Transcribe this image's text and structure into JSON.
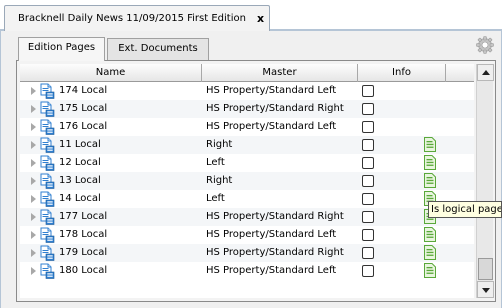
{
  "document_tab": {
    "title": "Bracknell Daily News 11/09/2015 First Edition",
    "close_label": "x"
  },
  "tabs": {
    "edition_pages": "Edition Pages",
    "ext_documents": "Ext. Documents"
  },
  "columns": {
    "name": "Name",
    "master": "Master",
    "info": "Info"
  },
  "rows": [
    {
      "name": "174 Local",
      "master": "HS Property/Standard Left",
      "logical": false
    },
    {
      "name": "175 Local",
      "master": "HS Property/Standard Right",
      "logical": false
    },
    {
      "name": "176 Local",
      "master": "HS Property/Standard Left",
      "logical": false
    },
    {
      "name": "11 Local",
      "master": "Right",
      "logical": true
    },
    {
      "name": "12 Local",
      "master": "Left",
      "logical": true
    },
    {
      "name": "13 Local",
      "master": "Right",
      "logical": true
    },
    {
      "name": "14 Local",
      "master": "Left",
      "logical": true
    },
    {
      "name": "177 Local",
      "master": "HS Property/Standard Right",
      "logical": true
    },
    {
      "name": "178 Local",
      "master": "HS Property/Standard Left",
      "logical": true
    },
    {
      "name": "179 Local",
      "master": "HS Property/Standard Right",
      "logical": true
    },
    {
      "name": "180 Local",
      "master": "HS Property/Standard Left",
      "logical": true
    }
  ],
  "tooltip": "Is logical page",
  "icons": {
    "settings": "gear-icon",
    "page": "page-icon",
    "logical_page": "logical-page-icon",
    "expander": "expand-arrow-icon"
  },
  "colors": {
    "page_icon_blue": "#2f7fd0",
    "logical_green": "#5aa83a",
    "tooltip_bg": "#ffffe1"
  }
}
